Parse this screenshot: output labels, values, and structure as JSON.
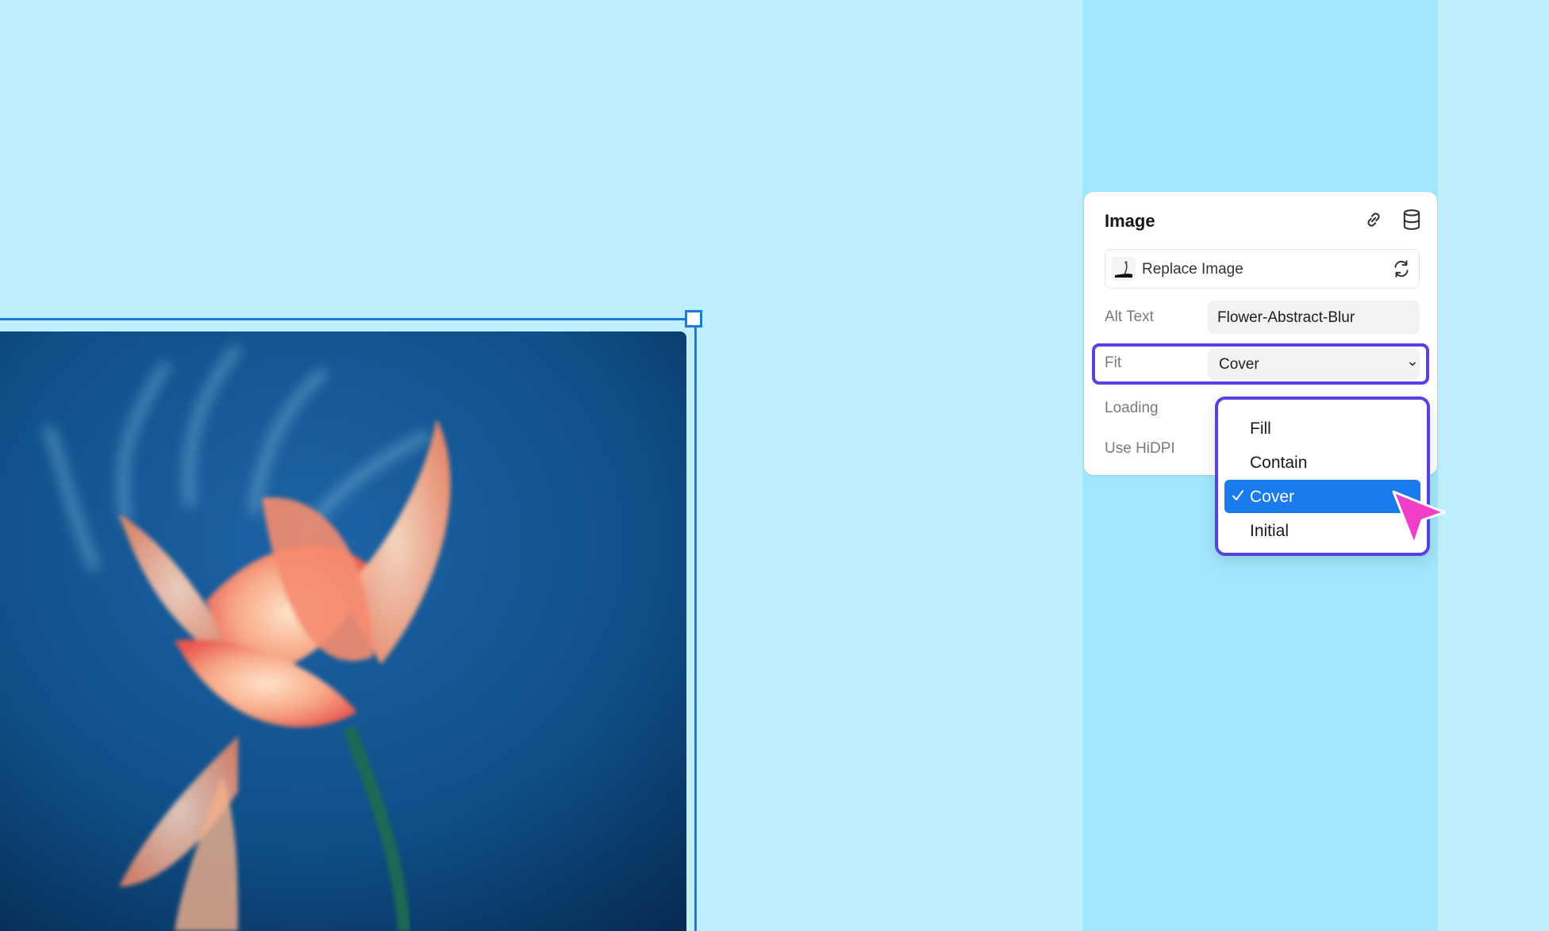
{
  "panel": {
    "title": "Image",
    "replace_label": "Replace Image",
    "alt_text": {
      "label": "Alt Text",
      "value": "Flower-Abstract-Blur"
    },
    "fit": {
      "label": "Fit",
      "value": "Cover"
    },
    "loading": {
      "label": "Loading"
    },
    "hidpi": {
      "label": "Use HiDPI"
    }
  },
  "dropdown": {
    "options": [
      "Fill",
      "Contain",
      "Cover",
      "Initial"
    ],
    "selected": "Cover"
  },
  "icons": {
    "link": "link-icon",
    "database": "database-icon",
    "swap": "swap-icon",
    "chevron": "chevron-down-icon",
    "check": "check-icon",
    "cursor": "cursor-pointer-icon"
  },
  "colors": {
    "canvas_bg": "#bfeffd",
    "column_band": "#a2e6fb",
    "selection": "#1a7bdf",
    "highlight": "#5a3fe2",
    "selected_option": "#1a7bef",
    "cursor": "#f23fc8"
  }
}
